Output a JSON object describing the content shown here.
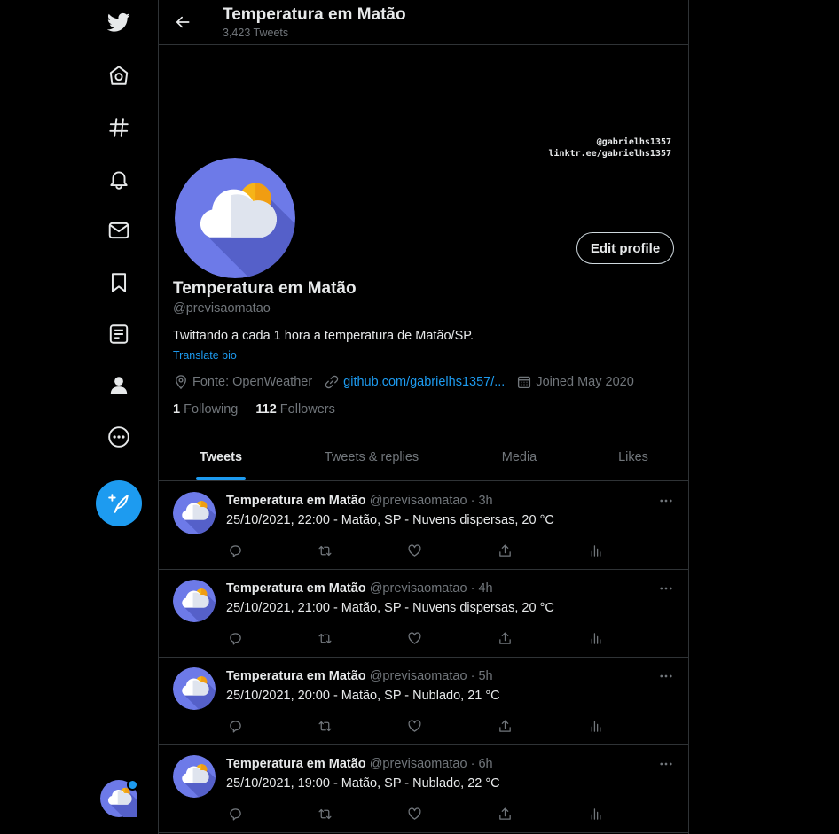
{
  "header": {
    "title": "Temperatura em Matão",
    "tweet_count": "3,423 Tweets"
  },
  "banner": {
    "line1": "@gabrielhs1357",
    "line2": "linktr.ee/gabrielhs1357"
  },
  "profile": {
    "name": "Temperatura em Matão",
    "handle": "@previsaomatao",
    "bio": "Twittando a cada 1 hora a temperatura de Matão/SP.",
    "translate": "Translate bio",
    "location": "Fonte: OpenWeather",
    "link": "github.com/gabrielhs1357/...",
    "joined": "Joined May 2020",
    "following_count": "1",
    "following_label": "Following",
    "followers_count": "112",
    "followers_label": "Followers",
    "edit_label": "Edit profile"
  },
  "tabs": [
    {
      "label": "Tweets"
    },
    {
      "label": "Tweets & replies"
    },
    {
      "label": "Media"
    },
    {
      "label": "Likes"
    }
  ],
  "tweets": [
    {
      "name": "Temperatura em Matão",
      "handle": "@previsaomatao",
      "dot": "·",
      "time": "3h",
      "text": "25/10/2021, 22:00 - Matão, SP - Nuvens dispersas, 20 °C"
    },
    {
      "name": "Temperatura em Matão",
      "handle": "@previsaomatao",
      "dot": "·",
      "time": "4h",
      "text": "25/10/2021, 21:00 - Matão, SP - Nuvens dispersas, 20 °C"
    },
    {
      "name": "Temperatura em Matão",
      "handle": "@previsaomatao",
      "dot": "·",
      "time": "5h",
      "text": "25/10/2021, 20:00 - Matão, SP - Nublado, 21 °C"
    },
    {
      "name": "Temperatura em Matão",
      "handle": "@previsaomatao",
      "dot": "·",
      "time": "6h",
      "text": "25/10/2021, 19:00 - Matão, SP - Nublado, 22 °C"
    }
  ],
  "icons": {
    "sidebar": [
      "twitter-logo-icon",
      "home-icon",
      "explore-hashtag-icon",
      "notifications-bell-icon",
      "messages-envelope-icon",
      "bookmarks-icon",
      "lists-icon",
      "profile-person-icon",
      "more-circle-icon"
    ],
    "tweet_actions": [
      "reply-icon",
      "retweet-icon",
      "like-heart-icon",
      "share-icon",
      "analytics-icon"
    ]
  },
  "colors": {
    "accent": "#1d9bf0",
    "background": "#000000",
    "text": "#e7e9ea",
    "muted": "#71767b",
    "border": "#2f3336",
    "avatar_bg": "#6d7ae8",
    "sun": "#f6b418"
  }
}
